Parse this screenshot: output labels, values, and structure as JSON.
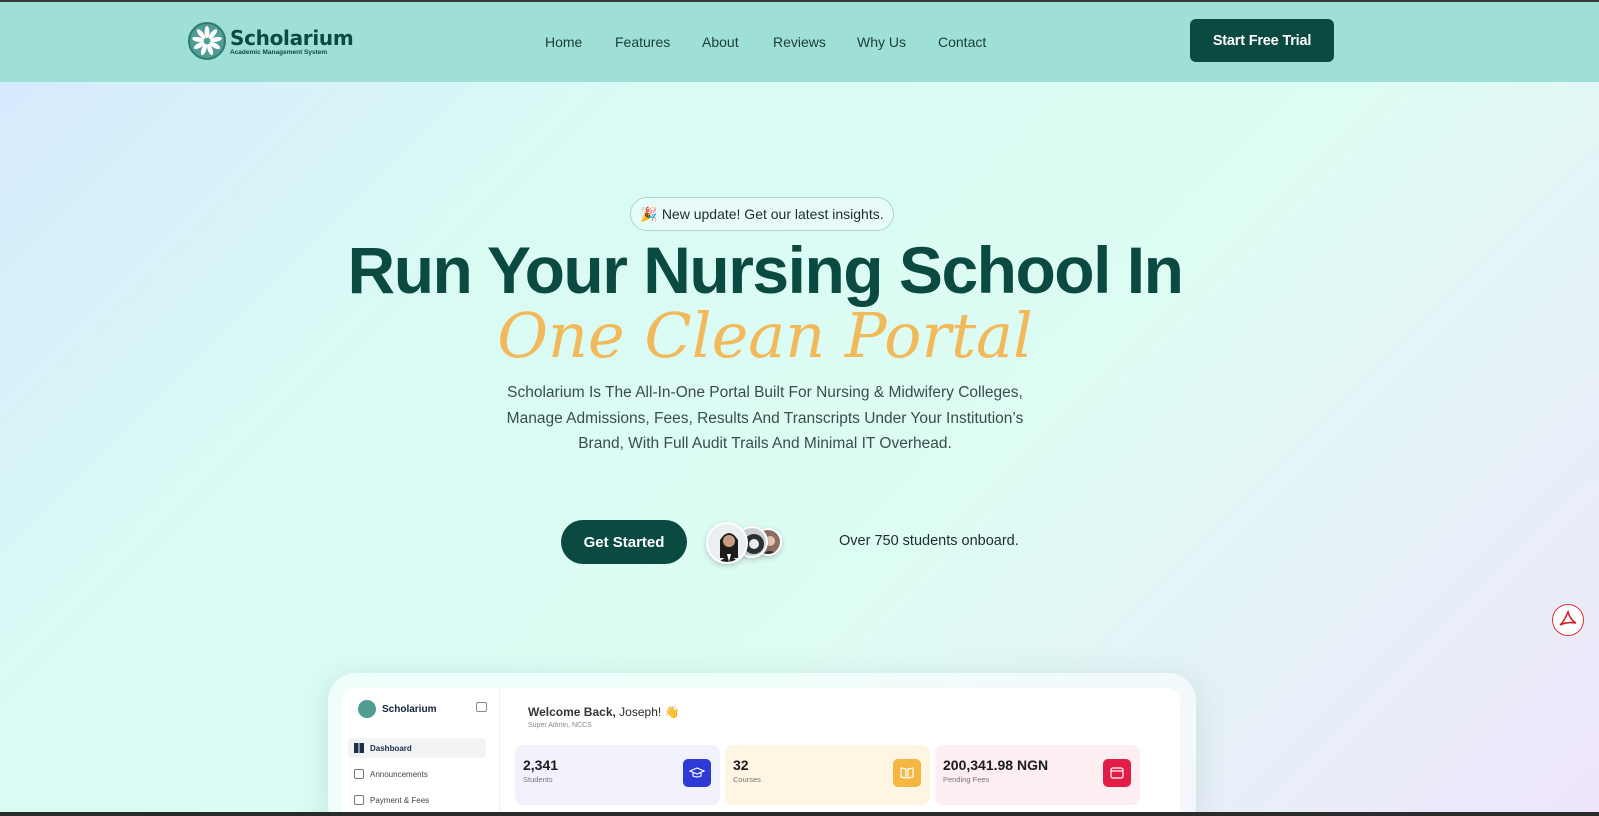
{
  "header": {
    "logo": {
      "name": "Scholarium",
      "tagline": "Academic Management System"
    },
    "nav": [
      "Home",
      "Features",
      "About",
      "Reviews",
      "Why Us",
      "Contact"
    ],
    "cta_label": "Start Free Trial"
  },
  "hero": {
    "pill_text": "New update! Get our latest insights.",
    "headline": "Run Your Nursing School In",
    "script_headline": "One Clean Portal",
    "description_lines": [
      "Scholarium Is The All-In-One Portal Built For Nursing & Midwifery Colleges,",
      "Manage Admissions, Fees, Results And Transcripts Under Your Institution’s",
      "Brand, With Full Audit Trails And Minimal IT Overhead."
    ],
    "get_started_label": "Get Started",
    "social_proof": "Over 750 students onboard."
  },
  "dashboard": {
    "brand": "Scholarium",
    "sidebar": [
      "Dashboard",
      "Announcements",
      "Payment & Fees"
    ],
    "welcome_bold": "Welcome Back,",
    "welcome_name": "Joseph! 👋",
    "welcome_sub": "Super Admin, NCCS",
    "stats": [
      {
        "value": "2,341",
        "label": "Students",
        "color": "#2d3ad6",
        "bg": "#f1f2fb"
      },
      {
        "value": "32",
        "label": "Courses",
        "color": "#f5b642",
        "bg": "#fff5e3"
      },
      {
        "value": "200,341.98 NGN",
        "label": "Pending Fees",
        "color": "#e11d48",
        "bg": "#fdeef1"
      }
    ]
  },
  "colors": {
    "primary": "#0b4a40",
    "accent": "#f2b95a",
    "header_bg": "#9ee0d6"
  }
}
